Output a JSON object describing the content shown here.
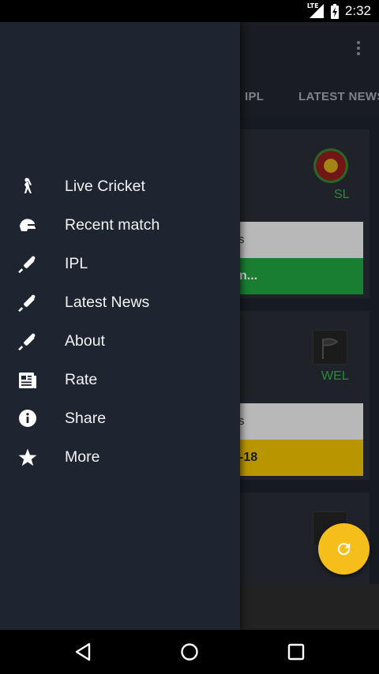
{
  "status_bar": {
    "network": "LTE",
    "time": "2:32"
  },
  "toolbar": {
    "overflow_icon": "more-vert-icon"
  },
  "tabs": [
    {
      "label": "IPL"
    },
    {
      "label": "LATEST NEWS"
    }
  ],
  "cards": [
    {
      "team_code": "SL",
      "strip_text": "s",
      "bar_text": "n..."
    },
    {
      "team_code": "WEL",
      "strip_text": "s",
      "bar_text": "-18"
    },
    {
      "team_code": ""
    }
  ],
  "drawer": {
    "items": [
      {
        "label": "Live Cricket",
        "icon": "batsman-icon"
      },
      {
        "label": "Recent match",
        "icon": "helmet-icon"
      },
      {
        "label": "IPL",
        "icon": "bat-ball-icon"
      },
      {
        "label": "Latest News",
        "icon": "bat-ball-icon"
      },
      {
        "label": "About",
        "icon": "bat-ball-icon"
      },
      {
        "label": "Rate",
        "icon": "news-icon"
      },
      {
        "label": "Share",
        "icon": "info-icon"
      },
      {
        "label": "More",
        "icon": "star-icon"
      }
    ]
  },
  "fab": {
    "icon": "refresh-icon"
  },
  "colors": {
    "drawer_bg": "#1e2530",
    "fab": "#f6be1a",
    "team_code": "#3aa54a",
    "bar_green": "#1f9a3d",
    "bar_yellow": "#e2b600"
  }
}
